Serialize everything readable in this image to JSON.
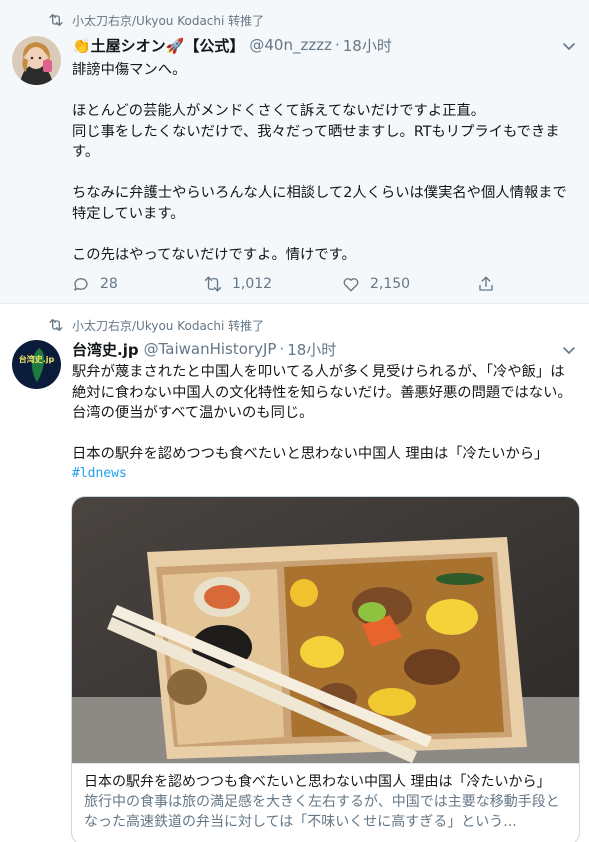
{
  "tweets": [
    {
      "retweeter_line": "小太刀右京/Ukyou Kodachi 转推了",
      "author": {
        "display_name": "👏土屋シオン🚀【公式】",
        "handle": "@40n_zzzz",
        "time": "18小时"
      },
      "text": "誹謗中傷マンへ。\n\nほとんどの芸能人がメンドくさくて訴えてないだけですよ正直。\n同じ事をしたくないだけで、我々だって晒せますし。RTもリプライもできます。\n\nちなみに弁護士やらいろんな人に相談して2人くらいは僕実名や個人情報まで特定しています。\n\nこの先はやってないだけですよ。情けです。",
      "stats": {
        "replies": "28",
        "retweets": "1,012",
        "likes": "2,150"
      }
    },
    {
      "retweeter_line": "小太刀右京/Ukyou Kodachi 转推了",
      "author": {
        "display_name": "台湾史.jp",
        "handle": "@TaiwanHistoryJP",
        "time": "18小时",
        "avatar_text": "台湾史.jp"
      },
      "text": "駅弁が蔑まされたと中国人を叩いてる人が多く見受けられるが、「冷や飯」は絶対に食わない中国人の文化特性を知らないだけ。善悪好悪の問題ではない。台湾の便当がすべて温かいのも同じ。\n\n日本の駅弁を認めつつも食べたいと思わない中国人 理由は「冷たいから」",
      "hashtag": "#ldnews",
      "card": {
        "title": "日本の駅弁を認めつつも食べたいと思わない中国人 理由は「冷たいから」",
        "description": "旅行中の食事は旅の満足感を大きく左右するが、中国では主要な移動手段となった高速鉄道の弁当に対しては「不味いくせに高すぎる」という..."
      }
    }
  ],
  "colors": {
    "accent": "#1da1f2",
    "secondary_text": "#657786",
    "primary_text": "#14171a",
    "highlight_bg": "#f5f8fa"
  }
}
